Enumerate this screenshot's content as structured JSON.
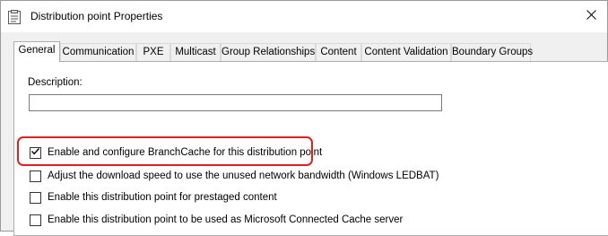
{
  "window": {
    "title": "Distribution point Properties",
    "app_icon": "properties-sheet-icon",
    "close_icon": "close-icon"
  },
  "tabs": [
    {
      "label": "General",
      "active": true
    },
    {
      "label": "Communication",
      "active": false
    },
    {
      "label": "PXE",
      "active": false
    },
    {
      "label": "Multicast",
      "active": false
    },
    {
      "label": "Group Relationships",
      "active": false
    },
    {
      "label": "Content",
      "active": false
    },
    {
      "label": "Content Validation",
      "active": false
    },
    {
      "label": "Boundary Groups",
      "active": false
    }
  ],
  "general": {
    "description_label": "Description:",
    "description_value": "",
    "options": [
      {
        "label": "Enable and configure BranchCache for this distribution point",
        "checked": true,
        "highlighted": true
      },
      {
        "label": "Adjust the download speed to use the unused network bandwidth (Windows LEDBAT)",
        "checked": false
      },
      {
        "label": "Enable this distribution point for prestaged content",
        "checked": false
      },
      {
        "label": "Enable this distribution point to be used as Microsoft Connected Cache server",
        "checked": false
      }
    ]
  },
  "colors": {
    "highlight": "#e02020",
    "window_bg": "#f0f0f0",
    "panel_bg": "#ffffff"
  }
}
